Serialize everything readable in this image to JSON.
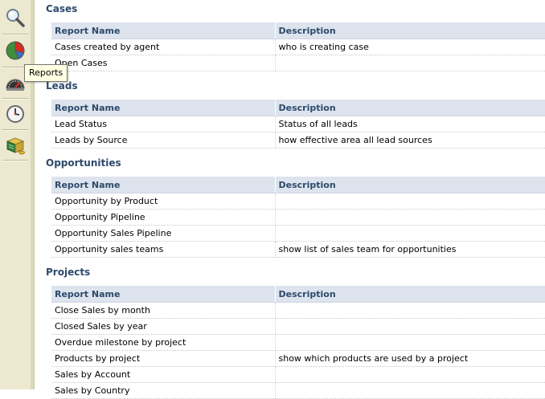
{
  "toolbar": {
    "icons": [
      "search-icon",
      "reports-pie-icon",
      "dashboard-gauge-icon",
      "clock-icon",
      "products-stack-icon"
    ],
    "tooltip": "Reports"
  },
  "sections": [
    {
      "title": "Cases",
      "headers": [
        "Report Name",
        "Description"
      ],
      "rows": [
        [
          "Cases created by agent",
          "who is creating case"
        ],
        [
          "Open Cases",
          ""
        ]
      ]
    },
    {
      "title": "Leads",
      "headers": [
        "Report Name",
        "Description"
      ],
      "rows": [
        [
          "Lead Status",
          "Status of all leads"
        ],
        [
          "Leads by Source",
          "how effective area all lead sources"
        ]
      ]
    },
    {
      "title": "Opportunities",
      "headers": [
        "Report Name",
        "Description"
      ],
      "rows": [
        [
          "Opportunity by Product",
          ""
        ],
        [
          "Opportunity Pipeline",
          ""
        ],
        [
          "Opportunity Sales Pipeline",
          ""
        ],
        [
          "Opportunity sales teams",
          "show list of sales team for opportunities"
        ]
      ]
    },
    {
      "title": "Projects",
      "headers": [
        "Report Name",
        "Description"
      ],
      "rows": [
        [
          "Close Sales by month",
          ""
        ],
        [
          "Closed Sales by year",
          ""
        ],
        [
          "Overdue milestone by project",
          ""
        ],
        [
          "Products by project",
          "show which products are used by a project"
        ],
        [
          "Sales by Account",
          ""
        ],
        [
          "Sales by Country",
          ""
        ]
      ]
    }
  ]
}
